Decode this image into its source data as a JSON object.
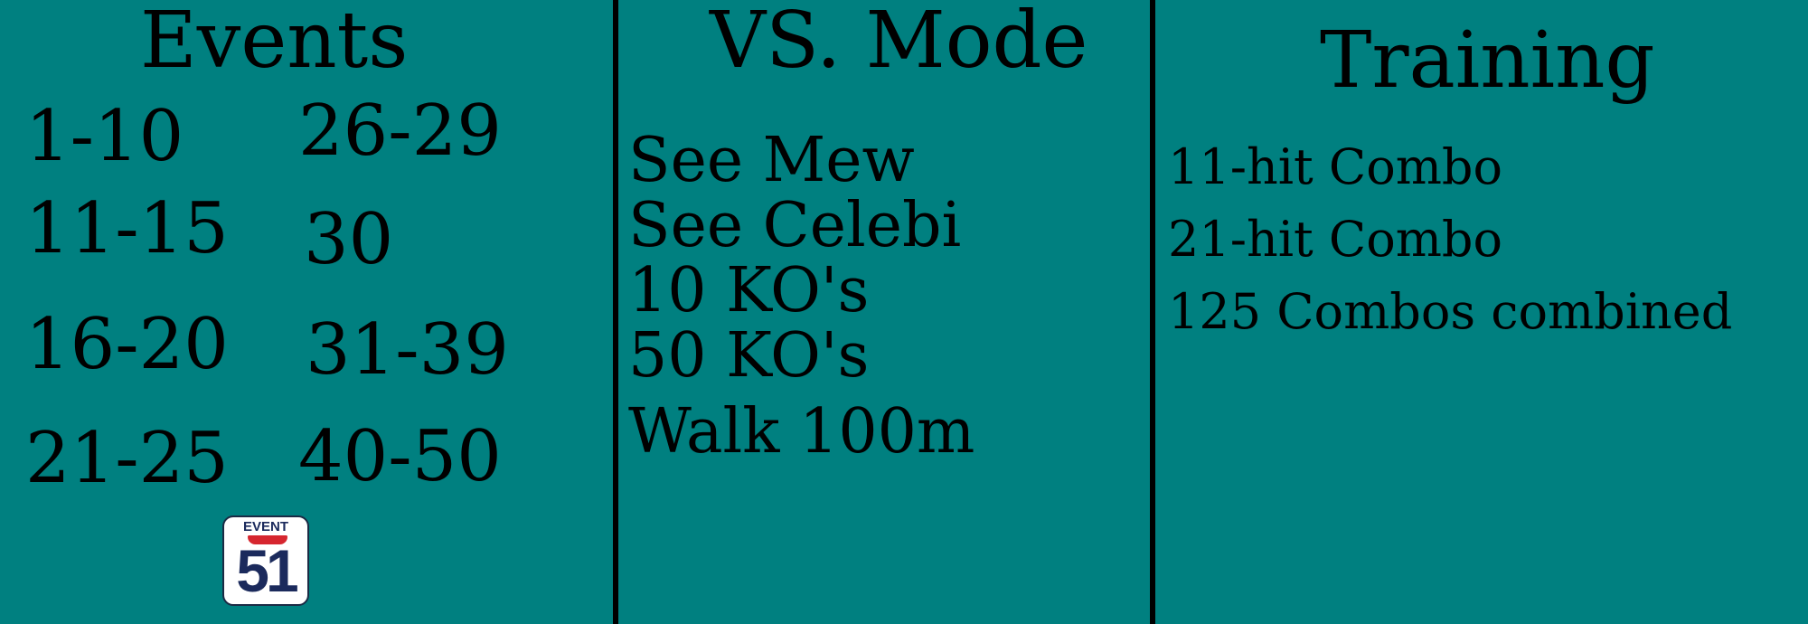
{
  "colors": {
    "background": "#008080",
    "text": "#000000",
    "divider": "#000000",
    "logo_navy": "#1b2a5c",
    "logo_red": "#d6262f"
  },
  "events": {
    "title": "Events",
    "ranges": [
      "1-10",
      "26-29",
      "11-15",
      "30",
      "16-20",
      "31-39",
      "21-25",
      "40-50"
    ]
  },
  "vs_mode": {
    "title": "VS. Mode",
    "items": [
      "See Mew",
      "See Celebi",
      "10 KO's",
      "50 KO's",
      "Walk 100m"
    ]
  },
  "training": {
    "title": "Training",
    "items": [
      "11-hit Combo",
      "21-hit Combo",
      "125 Combos combined"
    ]
  },
  "logo": {
    "word": "EVENT",
    "number": "51"
  }
}
